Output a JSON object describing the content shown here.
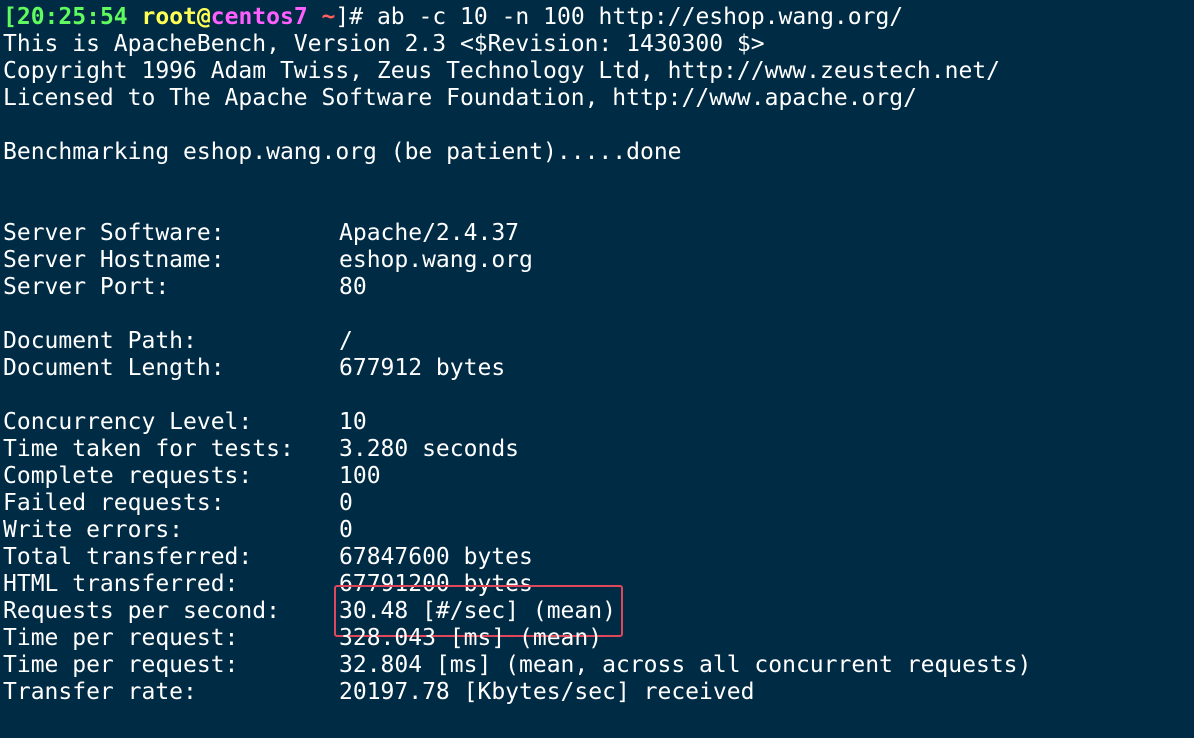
{
  "prompt": {
    "open_bracket": "[",
    "time": "20:25:54",
    "user": "root",
    "at": "@",
    "host": "centos7",
    "path": "~",
    "close": "]#",
    "command": " ab -c 10 -n 100 http://eshop.wang.org/"
  },
  "header_lines": [
    "This is ApacheBench, Version 2.3 <$Revision: 1430300 $>",
    "Copyright 1996 Adam Twiss, Zeus Technology Ltd, http://www.zeustech.net/",
    "Licensed to The Apache Software Foundation, http://www.apache.org/"
  ],
  "benchmarking_line": "Benchmarking eshop.wang.org (be patient).....done",
  "server": [
    {
      "key": "Server Software:",
      "value": "Apache/2.4.37"
    },
    {
      "key": "Server Hostname:",
      "value": "eshop.wang.org"
    },
    {
      "key": "Server Port:",
      "value": "80"
    }
  ],
  "document": [
    {
      "key": "Document Path:",
      "value": "/"
    },
    {
      "key": "Document Length:",
      "value": "677912 bytes"
    }
  ],
  "results": [
    {
      "key": "Concurrency Level:",
      "value": "10"
    },
    {
      "key": "Time taken for tests:",
      "value": "3.280 seconds"
    },
    {
      "key": "Complete requests:",
      "value": "100"
    },
    {
      "key": "Failed requests:",
      "value": "0"
    },
    {
      "key": "Write errors:",
      "value": "0"
    },
    {
      "key": "Total transferred:",
      "value": "67847600 bytes"
    },
    {
      "key": "HTML transferred:",
      "value": "67791200 bytes"
    },
    {
      "key": "Requests per second:",
      "value": "30.48 [#/sec] (mean)"
    },
    {
      "key": "Time per request:",
      "value": "328.043 [ms] (mean)"
    },
    {
      "key": "Time per request:",
      "value": "32.804 [ms] (mean, across all concurrent requests)"
    },
    {
      "key": "Transfer rate:",
      "value": "20197.78 [Kbytes/sec] received"
    }
  ],
  "colors": {
    "background": "#002b45",
    "text": "#ffffff",
    "prompt_green": "#5ffb5f",
    "prompt_yellow": "#ffff54",
    "prompt_magenta": "#ff5fff",
    "prompt_red": "#ff5f5f",
    "highlight_box": "#e0475a"
  }
}
